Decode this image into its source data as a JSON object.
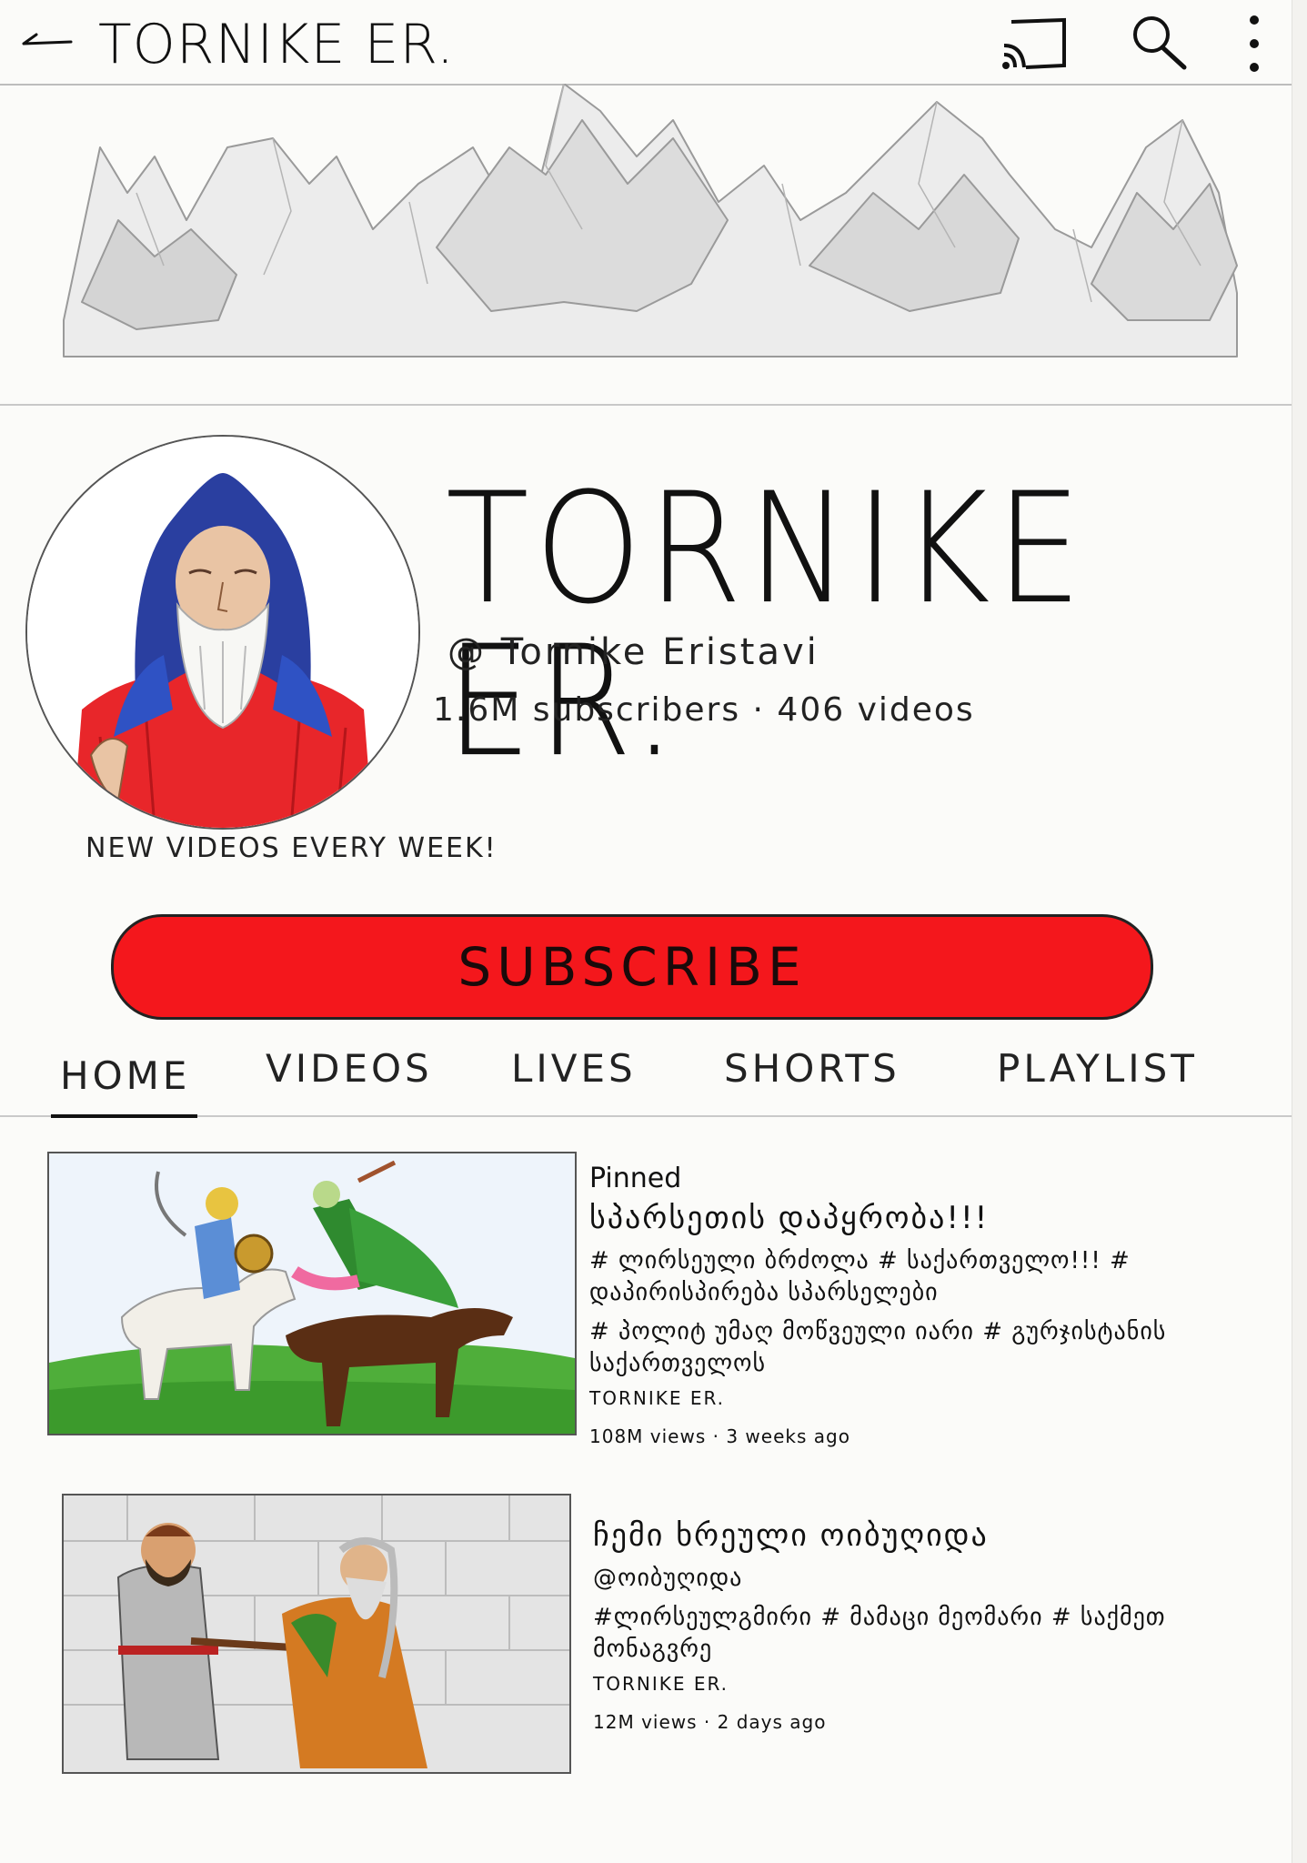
{
  "topbar": {
    "title": "TORNIKE ER.",
    "icons": [
      "back-arrow-icon",
      "cast-icon",
      "search-icon",
      "more-vertical-icon"
    ]
  },
  "channel": {
    "name": "TORNIKE ER.",
    "handle": "@ Tornike Eristavi",
    "stats": "1.6M subscribers · 406 videos",
    "tagline": "NEW VIDEOS EVERY WEEK!"
  },
  "subscribe_label": "SUBSCRIBE",
  "tabs": [
    {
      "label": "HOME",
      "active": true
    },
    {
      "label": "VIDEOS",
      "active": false
    },
    {
      "label": "LIVES",
      "active": false
    },
    {
      "label": "SHORTS",
      "active": false
    },
    {
      "label": "PLAYLIST",
      "active": false
    }
  ],
  "videos": [
    {
      "pinned": "Pinned",
      "title": "სპარსეთის დაპყრობა!!!",
      "tags": [
        "# ლირსეული ბრძოლა # საქართველო!!! # დაპირისპირება სპარსელები",
        "# პოლიტ უმაღ მოწვეული იარი # გურჯისტანის საქართველოს"
      ],
      "channel": "TORNIKE ER.",
      "meta": "108M views · 3 weeks ago"
    },
    {
      "pinned": "",
      "title": "ჩემი ხრეული ოიბუღიდა",
      "tags": [
        "@ოიბუღიდა",
        "#ლირსეულგმირი # მამაცი მეომარი # საქმეთ მონაგვრე"
      ],
      "channel": "TORNIKE ER.",
      "meta": "12M views · 2 days ago"
    }
  ],
  "colors": {
    "subscribe_red": "#f4171c",
    "hood_blue": "#2a3fa0",
    "robe_red": "#e8262a",
    "grass_green": "#4fae3a"
  }
}
